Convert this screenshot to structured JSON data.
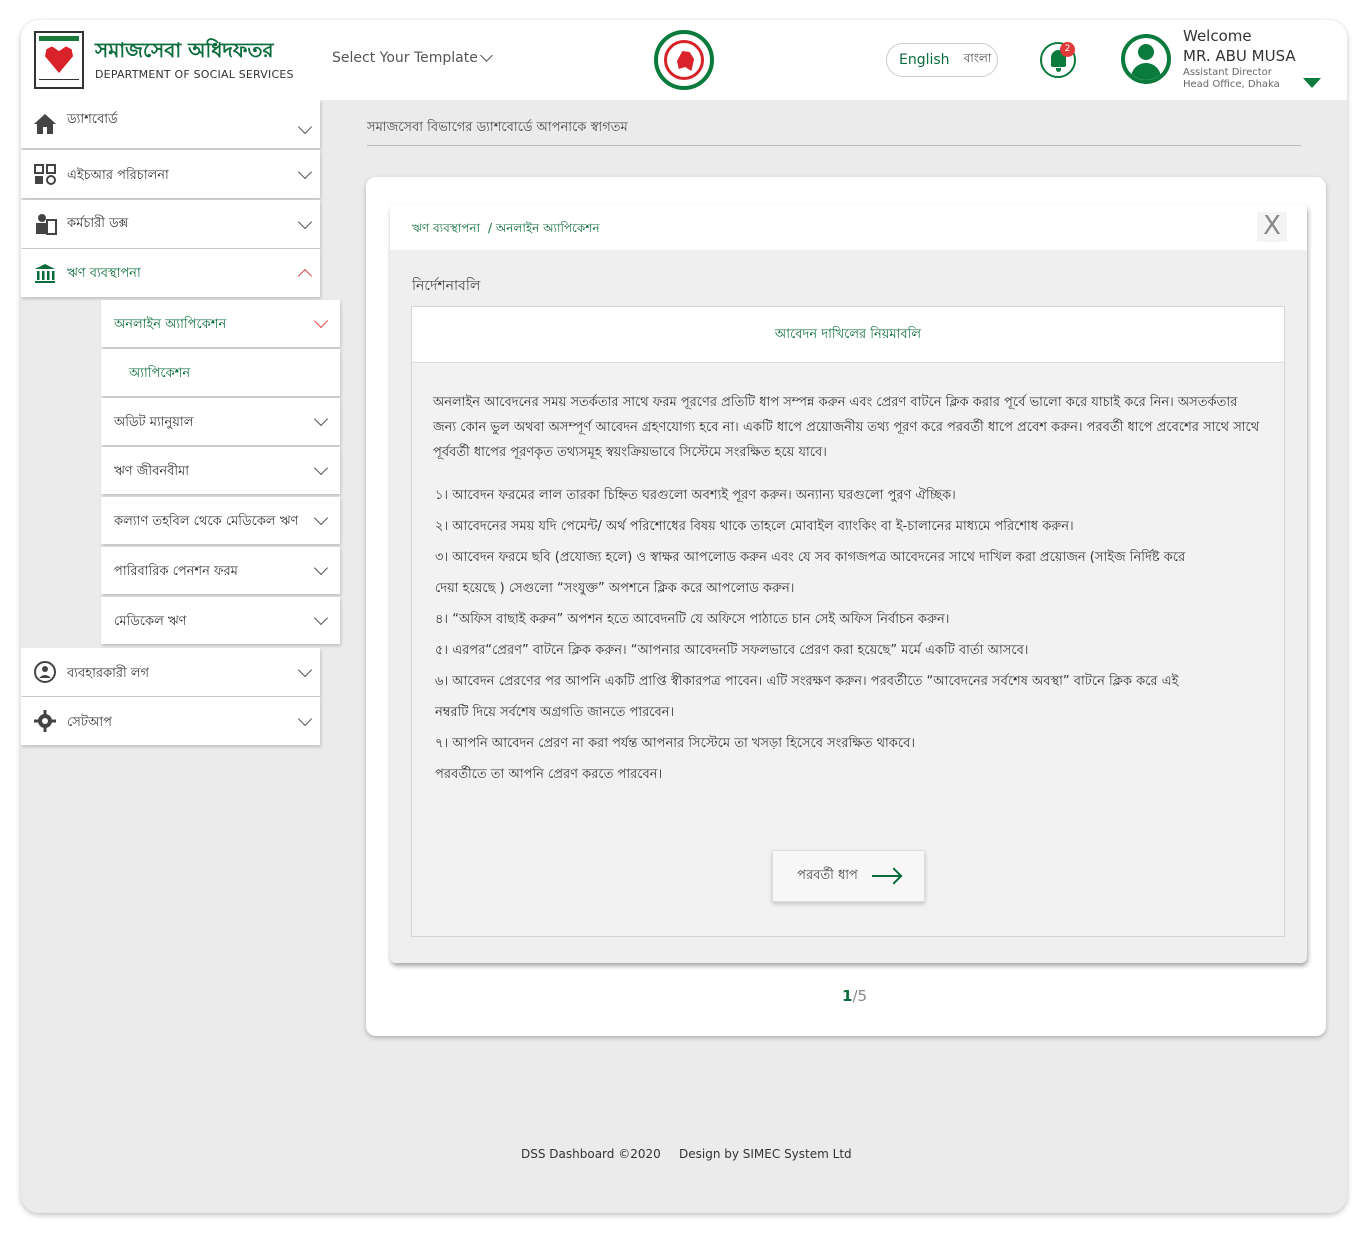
{
  "header": {
    "org_name_bn": "সমাজসেবা অধিদফতর",
    "org_name_en": "DEPARTMENT OF SOCIAL SERVICES",
    "template_select": "Select Your Template",
    "lang_en": "English",
    "lang_bn": "বাংলা",
    "notification_count": "2",
    "welcome": "Welcome",
    "user_name": "MR. ABU MUSA",
    "user_role": "Assistant Director",
    "user_office": "Head Office, Dhaka"
  },
  "sidebar": {
    "items": [
      {
        "label": "ড্যাশবোর্ড",
        "icon": "home-icon"
      },
      {
        "label": "এইচআর পরিচালনা",
        "icon": "hr-icon"
      },
      {
        "label": "কর্মচারী ডক্স",
        "icon": "employee-docs-icon"
      },
      {
        "label": "ঋণ ব্যবস্থাপনা",
        "icon": "bank-icon"
      },
      {
        "label": "ব্যবহারকারী লগ",
        "icon": "user-log-icon"
      },
      {
        "label": "সেটআপ",
        "icon": "gear-icon"
      }
    ],
    "sub_items": [
      {
        "label": "অনলাইন অ্যাপিকেশন"
      },
      {
        "label": "অ্যাপিকেশন"
      },
      {
        "label": "অডিট ম্যানুয়াল"
      },
      {
        "label": "ঋণ জীবনবীমা"
      },
      {
        "label": "কল্যাণ তহবিল থেকে মেডিকেল ঋণ"
      },
      {
        "label": "পারিবারিক পেনশন ফরম"
      },
      {
        "label": "মেডিকেল ঋণ"
      }
    ]
  },
  "main": {
    "welcome_line": "সমাজসেবা বিভাগের ড্যাশবোর্ডে আপনাকে স্বাগতম",
    "breadcrumb": [
      "ঋণ ব্যবস্থাপনা",
      "/ অনলাইন অ্যাপিকেশন"
    ],
    "close_label": "X",
    "instructions_title": "নির্দেশনাবলি",
    "rules_heading": "আবেদন দাখিলের নিয়মাবলি",
    "intro": "অনলাইন আবেদনের সময় সতর্কতার সাথে ফরম পূরণের প্রতিটি ধাপ সম্পন্ন করুন এবং প্রেরণ বাটনে ক্লিক করার পূর্বে ভালো করে যাচাই করে নিন। অসতর্কতার জন্য কোন ভুল অথবা অসম্পূর্ণ আবেদন গ্রহণযোগ্য হবে না। একটি ধাপে প্রয়োজনীয় তথ্য পূরণ করে পরবর্তী ধাপে প্রবেশ করুন। পরবর্তী ধাপে প্রবেশের সাথে সাথে পূর্ববর্তী ধাপের পূরণকৃত তথ্যসমূহ স্বয়ংক্রিয়ভাবে সিস্টেমে সংরক্ষিত হয়ে যাবে।",
    "rules": [
      "১। আবেদন ফরমের লাল তারকা চিহ্নিত ঘরগুলো অবশ্যই পূরণ করুন। অন্যান্য ঘরগুলো পুরণ ঐচ্ছিক।",
      "২। আবেদনের সময় যদি পেমেন্ট/ অর্থ পরিশোধের বিষয় থাকে তাহলে মোবাইল ব্যাংকিং বা ই-চালানের মাধ্যমে পরিশোধ করুন।",
      "৩। আবেদন ফরমে ছবি (প্রযোজ্য হলে) ও স্বাক্ষর আপলোড করুন এবং যে সব কাগজপত্র আবেদনের সাথে দাখিল করা প্রয়োজন (সাইজ নির্দিষ্ট করে",
      "দেয়া হয়েছে ) সেগুলো “সংযুক্ত” অপশনে ক্লিক করে আপলোড করুন।",
      "৪। “অফিস বাছাই করুন” অপশন হতে আবেদনটি যে অফিসে পাঠাতে চান সেই অফিস নির্বাচন করুন।",
      "৫। এরপর“প্রেরণ” বাটনে ক্লিক করুন। “আপনার আবেদনটি সফলভাবে প্রেরণ করা হয়েছে” মর্মে একটি বার্তা আসবে।",
      "৬। আবেদন প্রেরণের পর আপনি একটি প্রাপ্তি স্বীকারপত্র পাবেন। এটি সংরক্ষণ করুন। পরবর্তীতে “আবেদনের সর্বশেষ অবস্থা” বাটনে ক্লিক করে এই",
      "নম্বরটি দিয়ে সর্বশেষ অগ্রগতি জানতে পারবেন।",
      "৭। আপনি আবেদন প্রেরণ না করা পর্যন্ত আপনার সিস্টেমে তা খসড়া হিসেবে সংরক্ষিত থাকবে।",
      "পরবর্তীতে তা আপনি প্রেরণ করতে পারবেন।"
    ],
    "next_label": "পরবর্তী ধাপ",
    "page_current": "1",
    "page_total": "/5"
  },
  "footer": {
    "copyright": "DSS Dashboard ©2020",
    "credit": "Design by SIMEC System Ltd"
  },
  "colors": {
    "brand_green": "#0a6b3b",
    "alert_red": "#e23a3a"
  }
}
